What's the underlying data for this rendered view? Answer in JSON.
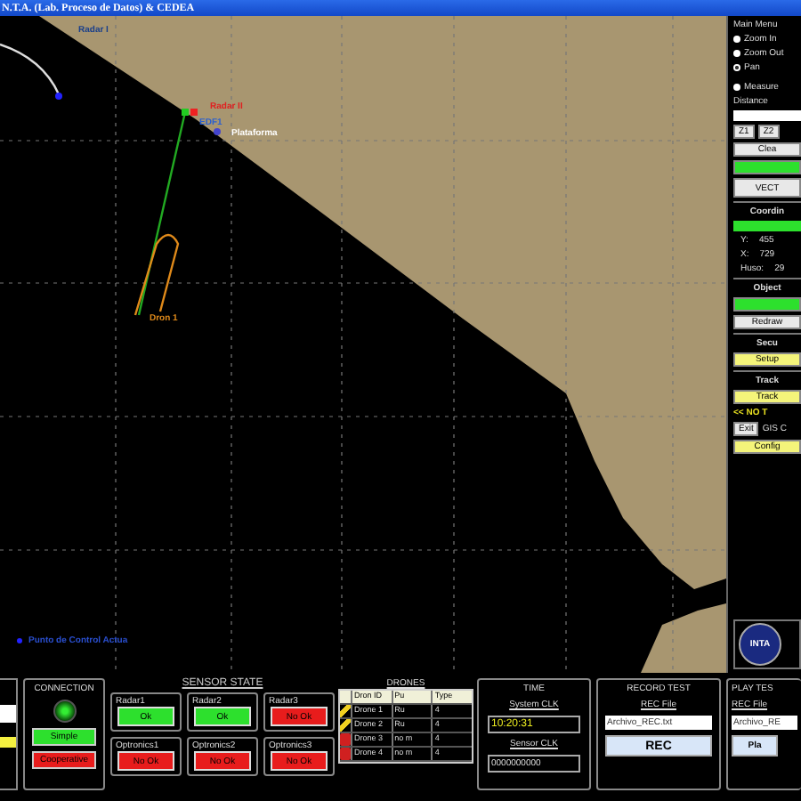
{
  "window": {
    "title": "N.T.A. (Lab. Proceso de Datos) & CEDEA"
  },
  "map": {
    "labels": [
      {
        "text": "Radar I",
        "color": "#1a3f8a"
      },
      {
        "text": "Radar II",
        "color": "#e02020"
      },
      {
        "text": "EDF1",
        "color": "#2a5fd0"
      },
      {
        "text": "Plataforma",
        "color": "#ffffff"
      },
      {
        "text": "Dron 1",
        "color": "#e08a1a"
      },
      {
        "text": "Punto de Control Actua",
        "color": "#2a4fd0"
      }
    ]
  },
  "main_menu": {
    "title": "Main Menu",
    "tools": [
      {
        "label": "Zoom In",
        "selected": false
      },
      {
        "label": "Zoom Out",
        "selected": false
      },
      {
        "label": "Pan",
        "selected": true
      },
      {
        "label": "Measure",
        "selected": false
      }
    ],
    "distance_label": "Distance",
    "zoom_buttons": [
      "Z1",
      "Z2"
    ],
    "clear_button": "Clea",
    "vector_button": "VECT",
    "coordinates_title": "Coordin",
    "coords": [
      {
        "axis": "Y:",
        "value": "455"
      },
      {
        "axis": "X:",
        "value": "729"
      },
      {
        "axis": "Huso:",
        "value": "29"
      }
    ],
    "objects_title": "Object",
    "redraw_button": "Redraw",
    "security_title": "Secu",
    "setup_button": "Setup",
    "tracks_title": "Track",
    "track_button": "Track",
    "track_status": "<< NO T",
    "exit_button": "Exit",
    "gis_label": "GIS C",
    "config_button": "Config",
    "logo_text": "INTA"
  },
  "connection": {
    "title": "CONNECTION",
    "led_on": true,
    "modes": [
      {
        "label": "Simple",
        "selected": true
      },
      {
        "label": "Cooperative",
        "selected": false
      }
    ]
  },
  "sensor_state": {
    "title": "SENSOR STATE",
    "sensors": [
      {
        "name": "Radar1",
        "status": "Ok",
        "ok": true
      },
      {
        "name": "Radar2",
        "status": "Ok",
        "ok": true
      },
      {
        "name": "Radar3",
        "status": "No Ok",
        "ok": false
      },
      {
        "name": "Optronics1",
        "status": "No Ok",
        "ok": false
      },
      {
        "name": "Optronics2",
        "status": "No Ok",
        "ok": false
      },
      {
        "name": "Optronics3",
        "status": "No Ok",
        "ok": false
      }
    ]
  },
  "drones": {
    "title": "DRONES",
    "columns": [
      "Dron ID",
      "Pu",
      "Type"
    ],
    "rows": [
      {
        "active": true,
        "cells": [
          "Drone 1",
          "Ru",
          "4"
        ]
      },
      {
        "active": true,
        "cells": [
          "Drone 2",
          "Ru",
          "4"
        ]
      },
      {
        "active": false,
        "cells": [
          "Drone 3",
          "no m",
          "4"
        ]
      },
      {
        "active": false,
        "cells": [
          "Drone 4",
          "no m",
          "4"
        ]
      }
    ]
  },
  "time": {
    "title": "TIME",
    "system_label": "System CLK",
    "system_value": "10:20:31",
    "sensor_label": "Sensor CLK",
    "sensor_value": "0000000000"
  },
  "record": {
    "title": "RECORD TEST",
    "file_label": "REC File",
    "file_value": "Archivo_REC.txt",
    "button": "REC"
  },
  "play": {
    "title": "PLAY TES",
    "file_label": "REC File",
    "file_value": "Archivo_RE",
    "button": "Pla"
  }
}
